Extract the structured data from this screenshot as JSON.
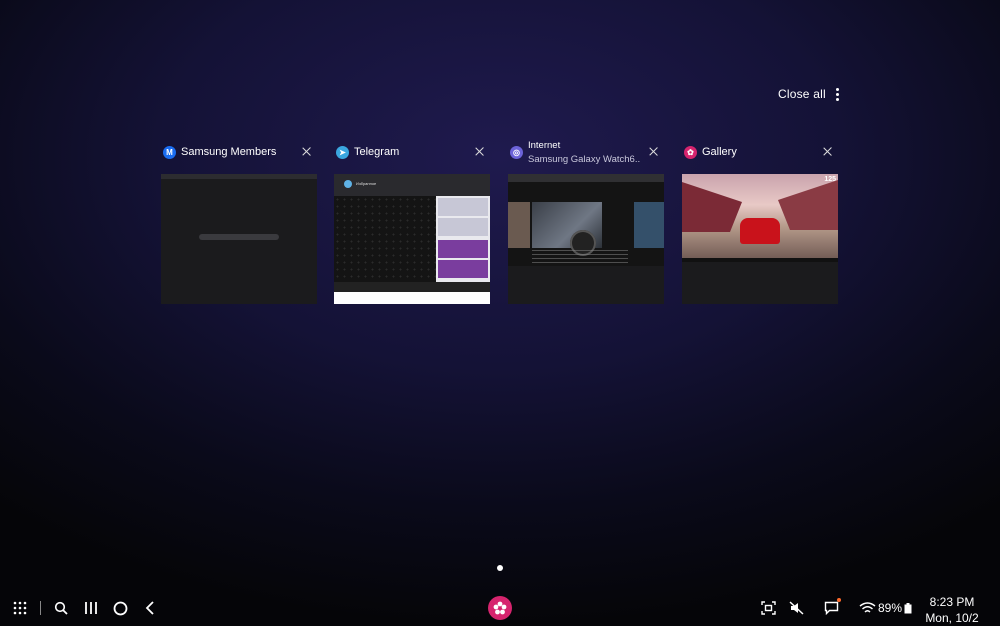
{
  "header": {
    "close_all_label": "Close all",
    "more_icon": "more-vertical-icon"
  },
  "recent_apps": [
    {
      "title": "Samsung Members",
      "subtitle": "",
      "icon": "samsung-members-icon",
      "icon_glyph": "M",
      "icon_color": "#1a6cf0"
    },
    {
      "title": "Telegram",
      "subtitle": "",
      "icon": "telegram-icon",
      "icon_glyph": "➤",
      "icon_color": "#3aa6df"
    },
    {
      "title": "Internet",
      "subtitle": "Samsung Galaxy Watch6..",
      "icon": "samsung-internet-icon",
      "icon_glyph": "◎",
      "icon_color": "#6c63d9"
    },
    {
      "title": "Gallery",
      "subtitle": "",
      "icon": "gallery-icon",
      "icon_glyph": "✿",
      "icon_color": "#d6246e"
    }
  ],
  "thumbnails": {
    "telegram_chat_title": "Избранное",
    "game_score": "125"
  },
  "taskbar": {
    "apps_icon": "apps-grid-icon",
    "search_icon": "search-icon",
    "recents_icon": "recents-icon",
    "home_icon": "home-icon",
    "back_icon": "back-icon",
    "pinned_app": "gallery-icon",
    "status": {
      "screenshot_icon": "screen-capture-icon",
      "mute_icon": "mute-icon",
      "message_icon": "message-icon",
      "wifi_icon": "wifi-icon",
      "battery_percent": "89%",
      "battery_icon": "battery-icon"
    },
    "time": "8:23 PM",
    "date": "Mon, 10/2",
    "accent_color": "#d6246e"
  }
}
